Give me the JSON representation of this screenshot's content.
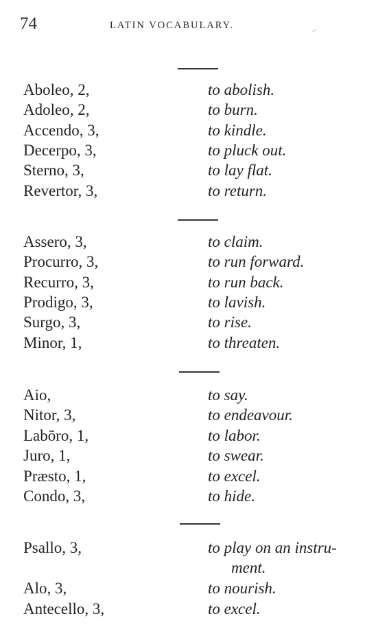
{
  "header": {
    "page_number": "74",
    "running_head": "LATIN VOCABULARY."
  },
  "groups": [
    {
      "entries": [
        {
          "latin": "Aboleo, 2,",
          "english": "to abolish."
        },
        {
          "latin": "Adoleo, 2,",
          "english": "to burn."
        },
        {
          "latin": "Accendo, 3,",
          "english": "to kindle."
        },
        {
          "latin": "Decerpo, 3,",
          "english": "to pluck out."
        },
        {
          "latin": "Sterno, 3,",
          "english": "to lay flat."
        },
        {
          "latin": "Revertor, 3,",
          "english": "to return."
        }
      ]
    },
    {
      "entries": [
        {
          "latin": "Assero, 3,",
          "english": "to claim."
        },
        {
          "latin": "Procurro, 3,",
          "english": "to run forward."
        },
        {
          "latin": "Recurro, 3,",
          "english": "to run back."
        },
        {
          "latin": "Prodigo, 3,",
          "english": "to lavish."
        },
        {
          "latin": "Surgo, 3,",
          "english": "to rise."
        },
        {
          "latin": "Minor, 1,",
          "english": "to threaten."
        }
      ]
    },
    {
      "entries": [
        {
          "latin": "Aio,",
          "english": "to say."
        },
        {
          "latin": "Nitor, 3,",
          "english": "to endeavour."
        },
        {
          "latin": "Labōro, 1,",
          "english": "to labor."
        },
        {
          "latin": "Juro, 1,",
          "english": "to swear."
        },
        {
          "latin": "Præsto, 1,",
          "english": "to excel."
        },
        {
          "latin": "Condo, 3,",
          "english": "to hide."
        }
      ]
    },
    {
      "entries": [
        {
          "latin": "Psallo, 3,",
          "english": "to play on an instru-",
          "english_continued": "ment."
        },
        {
          "latin": "Alo, 3,",
          "english": "to nourish."
        },
        {
          "latin": "Antecello, 3,",
          "english": "to excel."
        }
      ]
    }
  ]
}
